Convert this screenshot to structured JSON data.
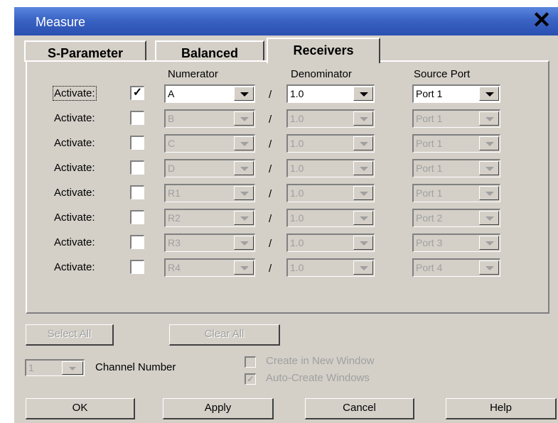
{
  "window": {
    "title": "Measure",
    "close_glyph": "✕"
  },
  "tabs": [
    {
      "label": "S-Parameter",
      "active": false
    },
    {
      "label": "Balanced",
      "active": false
    },
    {
      "label": "Receivers",
      "active": true
    }
  ],
  "columns": {
    "numerator": "Numerator",
    "denominator": "Denominator",
    "source_port": "Source Port"
  },
  "separator": "/",
  "rows": [
    {
      "label": "Activate:",
      "checked": true,
      "numerator": "A",
      "denominator": "1.0",
      "source_port": "Port 1",
      "enabled": true
    },
    {
      "label": "Activate:",
      "checked": false,
      "numerator": "B",
      "denominator": "1.0",
      "source_port": "Port 1",
      "enabled": false
    },
    {
      "label": "Activate:",
      "checked": false,
      "numerator": "C",
      "denominator": "1.0",
      "source_port": "Port 1",
      "enabled": false
    },
    {
      "label": "Activate:",
      "checked": false,
      "numerator": "D",
      "denominator": "1.0",
      "source_port": "Port 1",
      "enabled": false
    },
    {
      "label": "Activate:",
      "checked": false,
      "numerator": "R1",
      "denominator": "1.0",
      "source_port": "Port 1",
      "enabled": false
    },
    {
      "label": "Activate:",
      "checked": false,
      "numerator": "R2",
      "denominator": "1.0",
      "source_port": "Port 2",
      "enabled": false
    },
    {
      "label": "Activate:",
      "checked": false,
      "numerator": "R3",
      "denominator": "1.0",
      "source_port": "Port 3",
      "enabled": false
    },
    {
      "label": "Activate:",
      "checked": false,
      "numerator": "R4",
      "denominator": "1.0",
      "source_port": "Port 4",
      "enabled": false
    }
  ],
  "buttons": {
    "select_all": "Select All",
    "clear_all": "Clear All",
    "ok": "OK",
    "apply": "Apply",
    "cancel": "Cancel",
    "help": "Help"
  },
  "channel": {
    "value": "1",
    "label": "Channel Number"
  },
  "options": {
    "create_new_window": {
      "label": "Create in New Window",
      "checked": false,
      "enabled": false
    },
    "auto_create_windows": {
      "label": "Auto-Create Windows",
      "checked": true,
      "enabled": false
    }
  },
  "icons": {
    "close": "close-icon",
    "dropdown": "chevron-down-icon",
    "check": "checkmark-icon"
  }
}
